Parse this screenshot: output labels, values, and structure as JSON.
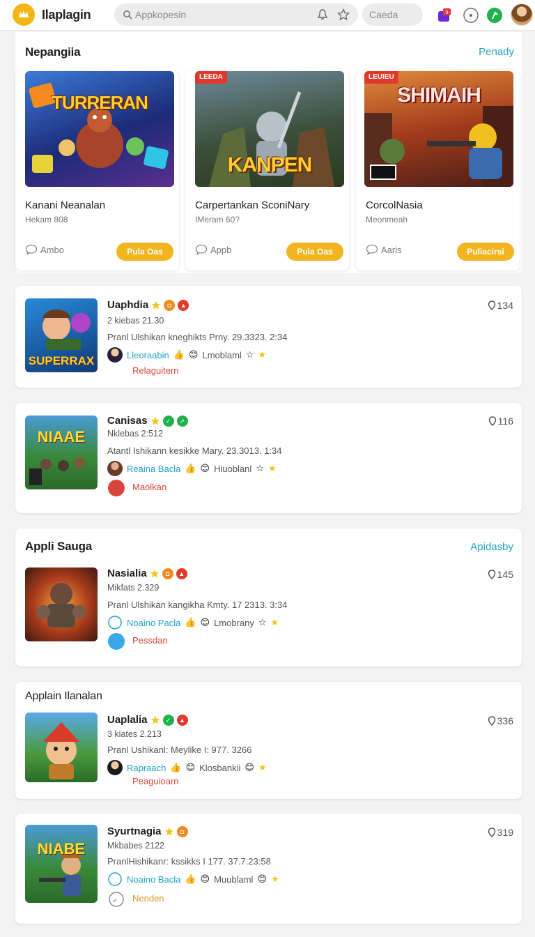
{
  "app": {
    "title": "Ilaplagin"
  },
  "search": {
    "placeholder": "Appkopesin",
    "secondary": "Caeda"
  },
  "featured": {
    "title": "Nepangiia",
    "link": "Penady",
    "cards": [
      {
        "name": "Kanani Neanalan",
        "sub": "Hekam 808",
        "comment": "Ambo",
        "button": "Pula Oas",
        "banner": "TURRERAN",
        "badge": ""
      },
      {
        "name": "Carpertankan SconiNary",
        "sub": "IMeram 60?",
        "comment": "Appb",
        "button": "Pula Oas",
        "banner": "KANPEN",
        "badge": "LEEDA"
      },
      {
        "name": "CorcolNasia",
        "sub": "Meonmeah",
        "comment": "Aaris",
        "button": "Puliacirsi",
        "banner": "SHIMAIH",
        "badge": "LEUIEU"
      }
    ]
  },
  "sections": [
    {
      "title": "",
      "link": ""
    },
    {
      "title": "Appli Sauga",
      "link": "Apidasby"
    },
    {
      "title": "Applain Ilanalan",
      "link": ""
    }
  ],
  "rows": [
    {
      "title": "Uaphdia",
      "sub": "2 kiebas 21.30",
      "desc": "Pranl Ulshikan kneghikts Prny. 29.3323. 2:34",
      "author": "Lleoraabin",
      "action": "Lmoblaml",
      "tag": "Relaguitern",
      "count": "134",
      "thumb_text": "SUPERRAX"
    },
    {
      "title": "Canisas",
      "sub": "Nklebas 2:512",
      "desc": "Atantl Ishikann kesikke Mary. 23.3013. 1:34",
      "author": "Reaina Bacla",
      "action": "Hiuoblanl",
      "tag": "Maolkan",
      "count": "116",
      "thumb_text": "NIAAE"
    },
    {
      "title": "Nasialia",
      "sub": "Mikfats 2.329",
      "desc": "Pranl Ulshikan kangikha Kmty. 17 2313. 3:34",
      "author": "Noaino Pacla",
      "action": "Lmobrany",
      "tag": "Pessdan",
      "count": "145",
      "thumb_text": ""
    },
    {
      "title": "Uaplalia",
      "sub": "3 kiates 2.213",
      "desc": "Pranl Ushikanl: Meylike I: 977. 3266",
      "author": "Rapraach",
      "action": "Klosbankii",
      "tag": "Peaguioarn",
      "count": "336",
      "thumb_text": ""
    },
    {
      "title": "Syurtnagia",
      "sub": "Mkbabes 2122",
      "desc": "PranlHishikanr: kssikks I 177. 37.7.23:58",
      "author": "Noaino Bacla",
      "action": "Muublaml",
      "tag": "Nenden",
      "count": "319",
      "thumb_text": "NIABE"
    }
  ],
  "colors": {
    "accent": "#f3b51f",
    "link": "#23a3c8",
    "tag": "#d9453a"
  }
}
